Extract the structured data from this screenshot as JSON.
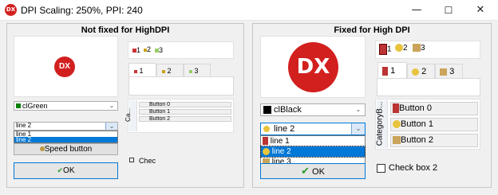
{
  "window": {
    "title": "DPI Scaling: 250%, PPI: 240",
    "app_icon_text": "DX",
    "controls": {
      "minimize": "—",
      "maximize": "☐",
      "close": "✕"
    }
  },
  "left": {
    "title": "Not fixed for HighDPI",
    "logo_text": "DX",
    "toolbar": [
      "1",
      "2",
      "3"
    ],
    "tabs": [
      "1",
      "2",
      "3"
    ],
    "color_combo": "clGreen",
    "image_combo": {
      "value": "line 2",
      "items": [
        "line 1",
        "line 2"
      ]
    },
    "speed_button": "Speed button",
    "ok_button": "OK",
    "category_caption": "Ca...",
    "category_buttons": [
      "Button 0",
      "Button 1",
      "Button 2"
    ],
    "checkbox_label": "Chec"
  },
  "right": {
    "title": "Fixed for High DPI",
    "logo_text": "DX",
    "toolbar": [
      "1",
      "2",
      "3"
    ],
    "tabs": [
      "1",
      "2",
      "3"
    ],
    "color_combo": "clBlack",
    "image_combo": {
      "value": "line 2",
      "items": [
        "line 1",
        "line 2",
        "line 3"
      ]
    },
    "ok_button": "OK",
    "category_caption": "CategoryB...",
    "category_buttons": [
      "Button 0",
      "Button 1",
      "Button 2"
    ],
    "checkbox_label": "Check box 2"
  },
  "colors": {
    "green": "#008000",
    "black": "#000000",
    "dx_red": "#d2201f",
    "selection": "#0078d7"
  }
}
